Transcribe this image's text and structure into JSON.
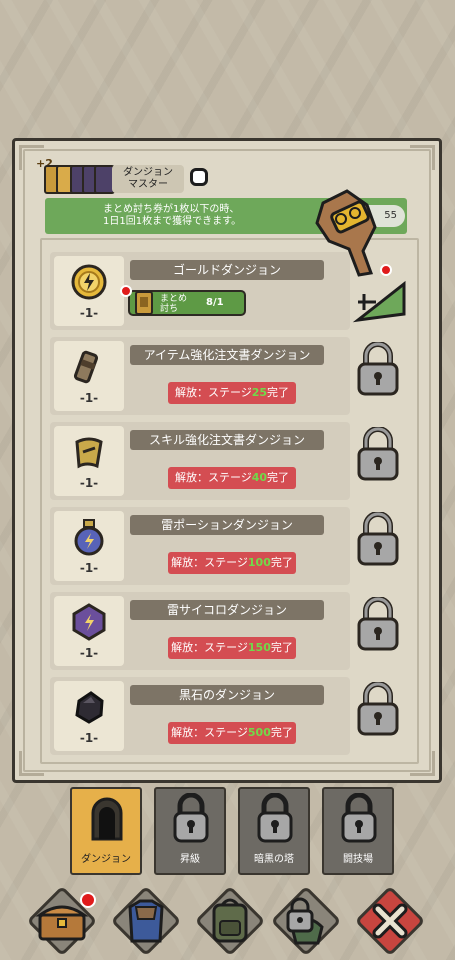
{
  "header": {
    "plus_badge": "+2",
    "master_title_line1": "ダンジョン",
    "master_title_line2": "マスター",
    "notice_line1": "まとめ討ち券が1枚以下の時、",
    "notice_line2": "1日1回1枚まで獲得できます。",
    "timer": "55"
  },
  "batch": {
    "label_line1": "まとめ",
    "label_line2": "討ち",
    "count": "8/1"
  },
  "dungeons": [
    {
      "title": "ゴールドダンジョン",
      "num": "-1-",
      "icon": "gold-coin-icon",
      "locked": false
    },
    {
      "title": "アイテム強化注文書ダンジョン",
      "num": "-1-",
      "icon": "item-scroll-icon",
      "locked": true,
      "unlock_prefix": "解放：ステージ",
      "stage": "25",
      "unlock_suffix": "完了"
    },
    {
      "title": "スキル強化注文書ダンジョン",
      "num": "-1-",
      "icon": "skill-scroll-icon",
      "locked": true,
      "unlock_prefix": "解放：ステージ",
      "stage": "40",
      "unlock_suffix": "完了"
    },
    {
      "title": "雷ポーションダンジョン",
      "num": "-1-",
      "icon": "thunder-potion-icon",
      "locked": true,
      "unlock_prefix": "解放：ステージ",
      "stage": "100",
      "unlock_suffix": "完了"
    },
    {
      "title": "雷サイコロダンジョン",
      "num": "-1-",
      "icon": "thunder-dice-icon",
      "locked": true,
      "unlock_prefix": "解放：ステージ",
      "stage": "150",
      "unlock_suffix": "完了"
    },
    {
      "title": "黒石のダンジョン",
      "num": "-1-",
      "icon": "black-stone-icon",
      "locked": true,
      "unlock_prefix": "解放：ステージ",
      "stage": "500",
      "unlock_suffix": "完了"
    }
  ],
  "tabs": [
    {
      "label": "ダンジョン",
      "active": true,
      "icon": "dungeon-gate-icon"
    },
    {
      "label": "昇級",
      "active": false,
      "icon": "lock-icon"
    },
    {
      "label": "暗黒の塔",
      "active": false,
      "icon": "lock-icon"
    },
    {
      "label": "闘技場",
      "active": false,
      "icon": "lock-icon"
    }
  ],
  "bottom_nav": [
    "treasure-chest-icon",
    "armor-icon",
    "backpack-icon",
    "locked-goblin-icon",
    "close-icon"
  ],
  "colors": {
    "green": "#6ea85a",
    "red": "#d44d52",
    "gold": "#e6b04a",
    "stage_green": "#71d94a"
  }
}
